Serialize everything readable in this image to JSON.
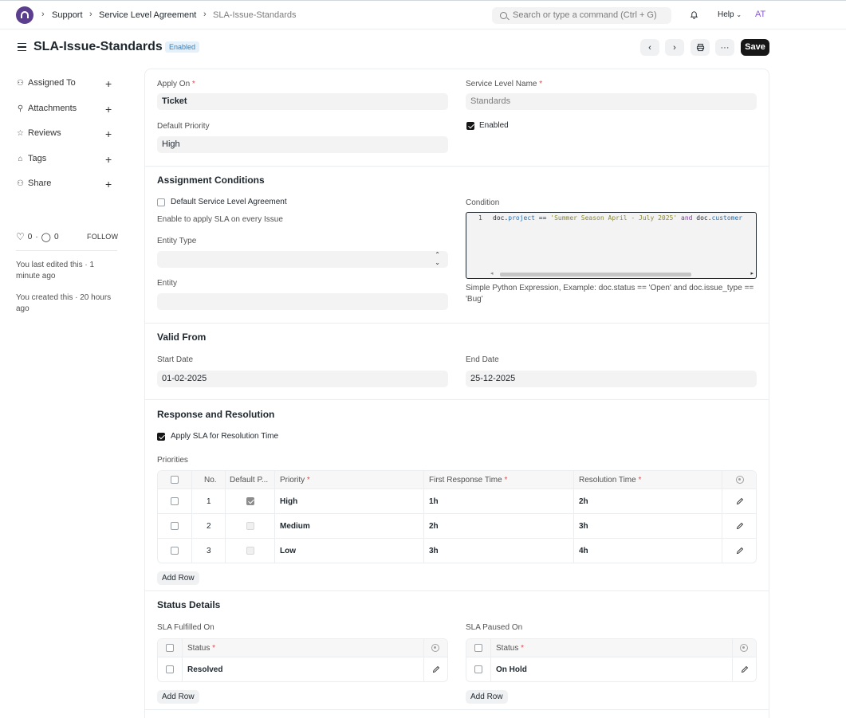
{
  "navbar": {
    "breadcrumbs": [
      "Support",
      "Service Level Agreement",
      "SLA-Issue-Standards"
    ],
    "search_placeholder": "Search or type a command (Ctrl + G)",
    "help_label": "Help",
    "avatar_initials": "AT"
  },
  "header": {
    "title": "SLA-Issue-Standards",
    "status_badge": "Enabled",
    "save_label": "Save"
  },
  "sidebar": {
    "items": [
      {
        "label": "Assigned To"
      },
      {
        "label": "Attachments"
      },
      {
        "label": "Reviews"
      },
      {
        "label": "Tags"
      },
      {
        "label": "Share"
      }
    ],
    "likes_count": "0",
    "comments_count": "0",
    "follow_label": "FOLLOW",
    "last_edited": "You last edited this · 1 minute ago",
    "created": "You created this · 20 hours ago"
  },
  "form": {
    "apply_on_label": "Apply On",
    "apply_on_value": "Ticket",
    "service_level_name_label": "Service Level Name",
    "service_level_name_value": "Standards",
    "default_priority_label": "Default Priority",
    "default_priority_value": "High",
    "enabled_label": "Enabled",
    "assignment": {
      "title": "Assignment Conditions",
      "default_sla_label": "Default Service Level Agreement",
      "default_sla_desc": "Enable to apply SLA on every Issue",
      "entity_type_label": "Entity Type",
      "entity_label": "Entity",
      "condition_label": "Condition",
      "condition_line_no": "1",
      "condition_code": {
        "p1": "doc.",
        "p2": "project",
        "p3": " == ",
        "p4": "'Summer Season April - July 2025'",
        "p5": " and ",
        "p6": "doc.",
        "p7": "customer"
      },
      "condition_desc": "Simple Python Expression, Example: doc.status == 'Open' and doc.issue_type == 'Bug'"
    },
    "valid_from": {
      "title": "Valid From",
      "start_date_label": "Start Date",
      "start_date_value": "01-02-2025",
      "end_date_label": "End Date",
      "end_date_value": "25-12-2025"
    },
    "response": {
      "title": "Response and Resolution",
      "apply_sla_label": "Apply SLA for Resolution Time",
      "priorities_label": "Priorities",
      "columns": {
        "no": "No.",
        "default_priority": "Default P...",
        "priority": "Priority",
        "first_response": "First Response Time",
        "resolution": "Resolution Time"
      },
      "rows": [
        {
          "no": "1",
          "priority": "High",
          "first_response": "1h",
          "resolution": "2h",
          "default": true
        },
        {
          "no": "2",
          "priority": "Medium",
          "first_response": "2h",
          "resolution": "3h",
          "default": false
        },
        {
          "no": "3",
          "priority": "Low",
          "first_response": "3h",
          "resolution": "4h",
          "default": false
        }
      ],
      "add_row_label": "Add Row"
    },
    "status_details": {
      "title": "Status Details",
      "fulfilled_label": "SLA Fulfilled On",
      "paused_label": "SLA Paused On",
      "status_col": "Status",
      "fulfilled_value": "Resolved",
      "paused_value": "On Hold",
      "add_row_label": "Add Row"
    }
  },
  "colors": {
    "accent": "#171717",
    "badge_bg": "#e4f1fb",
    "badge_text": "#2e7fc2",
    "required": "#e24c4c"
  }
}
